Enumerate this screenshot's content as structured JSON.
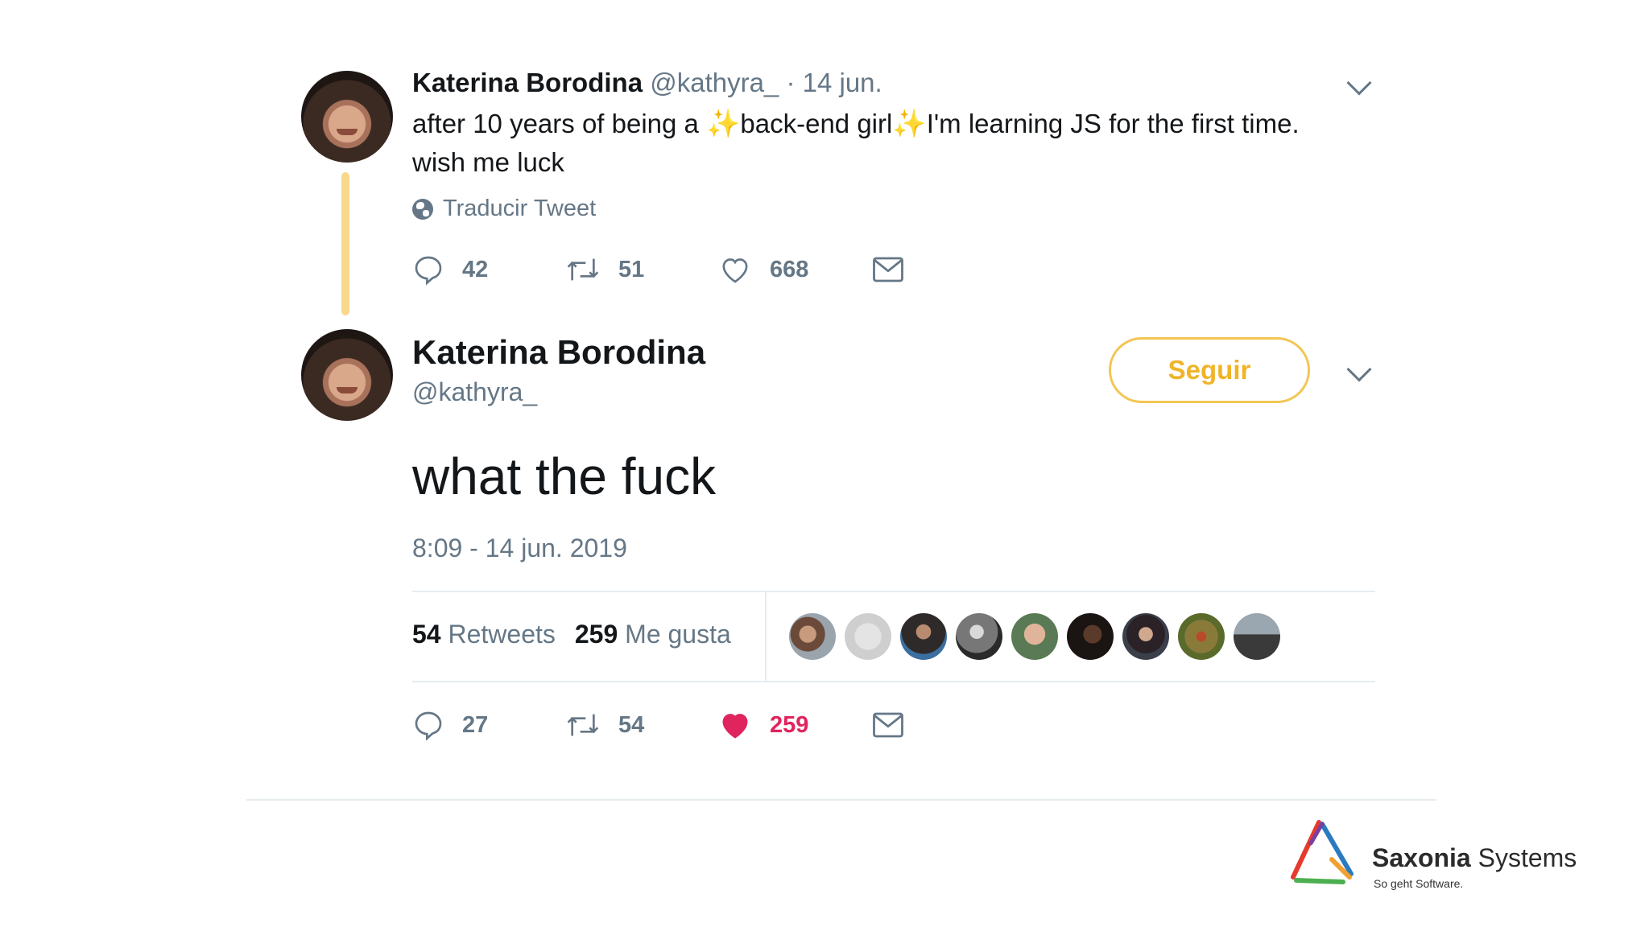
{
  "tweet1": {
    "author_name": "Katerina Borodina",
    "author_handle": "@kathyra_",
    "date": "· 14 jun.",
    "text_part1": "after 10 years of being a ",
    "text_part2": "back-end girl",
    "text_part3": "I'm learning JS for the first time.",
    "text_part4": "wish me luck",
    "sparkle_glyph": "✨",
    "translate_label": "Traducir Tweet",
    "actions": {
      "replies": "42",
      "retweets": "51",
      "likes": "668"
    }
  },
  "tweet2": {
    "author_name": "Katerina Borodina",
    "author_handle": "@kathyra_",
    "follow_label": "Seguir",
    "text": "what the fuck",
    "timestamp": "8:09 - 14 jun. 2019",
    "stats": {
      "retweets_count": "54",
      "retweets_label": "Retweets",
      "likes_count": "259",
      "likes_label": "Me gusta"
    },
    "actions": {
      "replies": "27",
      "retweets": "54",
      "likes": "259"
    }
  },
  "brand": {
    "name_bold": "Saxonia",
    "name_regular": " Systems",
    "tagline": "So geht Software."
  },
  "colors": {
    "accent": "#f0b428",
    "like": "#e0245e",
    "muted": "#657786",
    "thread_line": "#f8d98c"
  }
}
